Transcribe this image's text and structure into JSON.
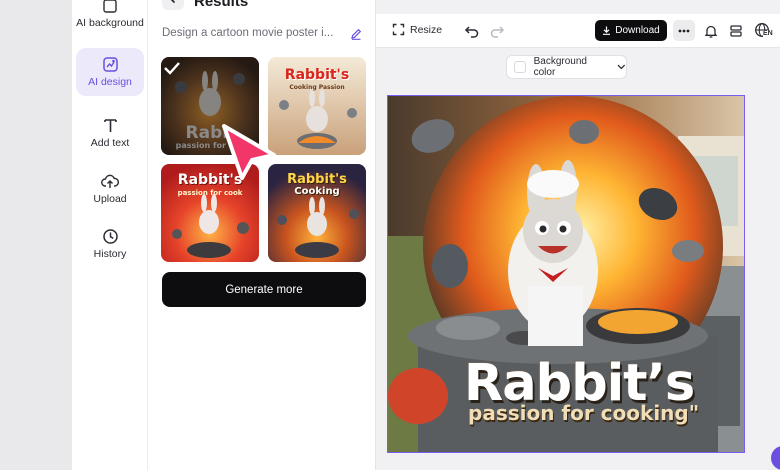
{
  "rail": {
    "items": [
      {
        "label": "AI background",
        "icon": "ai-background-icon"
      },
      {
        "label": "AI design",
        "icon": "ai-design-icon",
        "active": true
      },
      {
        "label": "Add text",
        "icon": "text-icon"
      },
      {
        "label": "Upload",
        "icon": "upload-icon"
      },
      {
        "label": "History",
        "icon": "history-icon"
      }
    ]
  },
  "panel": {
    "title": "Results",
    "prompt": "Design a cartoon movie poster i...",
    "results": [
      {
        "title": "Rabb",
        "subtitle": "passion for coo",
        "selected": true
      },
      {
        "title": "Rabbit's",
        "subtitle": "Cooking Passion"
      },
      {
        "title": "Rabbit's",
        "subtitle": "passion for cook"
      },
      {
        "title": "Rabbit's",
        "subtitle": "Cooking"
      }
    ],
    "generate_more": "Generate more"
  },
  "toolbar": {
    "resize": "Resize",
    "download": "Download",
    "language": "EN"
  },
  "canvas": {
    "background_color_label": "Background color",
    "poster_title": "Rabbit’s",
    "poster_subtitle": "passion for cooking\""
  },
  "colors": {
    "accent": "#6b4fe0",
    "button_dark": "#0d0d10",
    "cursor": "#f2366a"
  }
}
